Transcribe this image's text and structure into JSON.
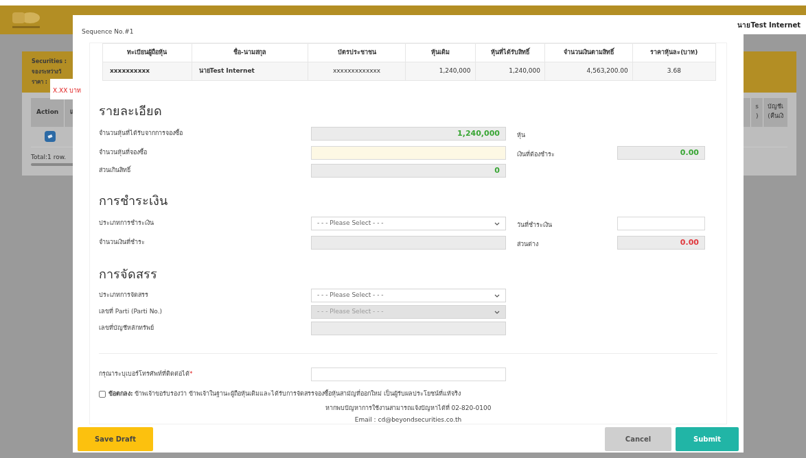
{
  "header": {
    "user_name": "นายTest Internet"
  },
  "background_card": {
    "lines": [
      "Securities :",
      "จองระหว่างวั",
      "ราคา :"
    ],
    "price_badge": "X.XX บาท",
    "left_columns": [
      "Action",
      "แ"
    ],
    "right_columns": [
      [
        "s",
        ")"
      ],
      [
        "บัญชีเ",
        "(คืนเงิ"
      ]
    ],
    "total": "Total:1 row."
  },
  "modal": {
    "title": "Sequence No.#1",
    "holder_table": {
      "columns": [
        "ทะเบียนผู้ถือหุ้น",
        "ชื่อ-นามสกุล",
        "บัตรประชาชน",
        "หุ้นเดิม",
        "หุ้นที่ได้รับสิทธิ์",
        "จำนวนเงินตามสิทธิ์",
        "ราคาหุ้นละ(บาท)"
      ],
      "rows": [
        [
          "xxxxxxxxxx",
          "นายTest Internet",
          "xxxxxxxxxxxxx",
          "1,240,000",
          "1,240,000",
          "4,563,200.00",
          "3.68"
        ]
      ]
    },
    "sections": [
      {
        "heading": "รายละเอียด",
        "rows": [
          {
            "label": "จำนวนหุ้นที่ได้รับจากการจองซื้อ",
            "field": {
              "kind": "readonly",
              "value": "1,240,000",
              "color": "#3aa635"
            },
            "side_label": "หุ้น"
          },
          {
            "label": "จำนวนหุ้นที่จองซื้อ",
            "field": {
              "kind": "input",
              "highlighted": true
            },
            "side_label": "เงินที่ต้องชำระ",
            "side_field": {
              "kind": "readonly",
              "value": "0.00",
              "color": "#3aa635"
            }
          },
          {
            "label": "ส่วนเกินสิทธิ์",
            "field": {
              "kind": "readonly",
              "value": "0",
              "color": "#3aa635"
            }
          }
        ]
      },
      {
        "heading": "การชำระเงิน",
        "rows": [
          {
            "label": "ประเภทการชำระเงิน",
            "field": {
              "kind": "select",
              "value": "- - - Please Select - - -",
              "disabled": false
            },
            "side_label": "วันที่ชำระเงิน",
            "side_field": {
              "kind": "input",
              "highlighted": false
            }
          },
          {
            "label": "จำนวนเงินที่ชำระ",
            "field": {
              "kind": "readonly"
            },
            "side_label": "ส่วนต่าง",
            "side_field": {
              "kind": "readonly",
              "value": "0.00",
              "color": "#e0393e"
            }
          }
        ]
      },
      {
        "heading": "การจัดสรร",
        "rows": [
          {
            "label": "ประเภทการจัดสรร",
            "field": {
              "kind": "select",
              "value": "- - - Please Select - - -",
              "disabled": false
            }
          },
          {
            "label": "เลขที่ Parti (Parti No.)",
            "field": {
              "kind": "select",
              "value": "- - - Please Select - - -",
              "disabled": true
            }
          },
          {
            "label": "เลขที่บัญชีหลักทรัพย์",
            "field": {
              "kind": "readonly"
            }
          }
        ]
      }
    ],
    "phone": {
      "label": "กรุณาระบุเบอร์โทรศัพท์ที่ติดต่อได้",
      "required_mark": "*"
    },
    "agreement": {
      "checked": false,
      "text": "**ข้อตกลง:** ข้าพเจ้าขอรับรองว่า ข้าพเจ้าในฐานะผู้ถือหุ้นเดิมและได้รับการจัดสรรจองซื้อหุ้นสามัญที่ออกใหม่ เป็นผู้รับผลประโยชน์ที่แท้จริง"
    },
    "footer_lines": [
      "หากพบปัญหาการใช้งานสามารถแจ้งปัญหาได้ที่ 02-820-0100",
      "Email : cd@beyondsecurities.co.th"
    ],
    "buttons": [
      {
        "kind": "draft",
        "label": "Save Draft"
      },
      {
        "kind": "cancel",
        "label": "Cancel"
      },
      {
        "kind": "submit",
        "label": "Submit"
      }
    ]
  }
}
